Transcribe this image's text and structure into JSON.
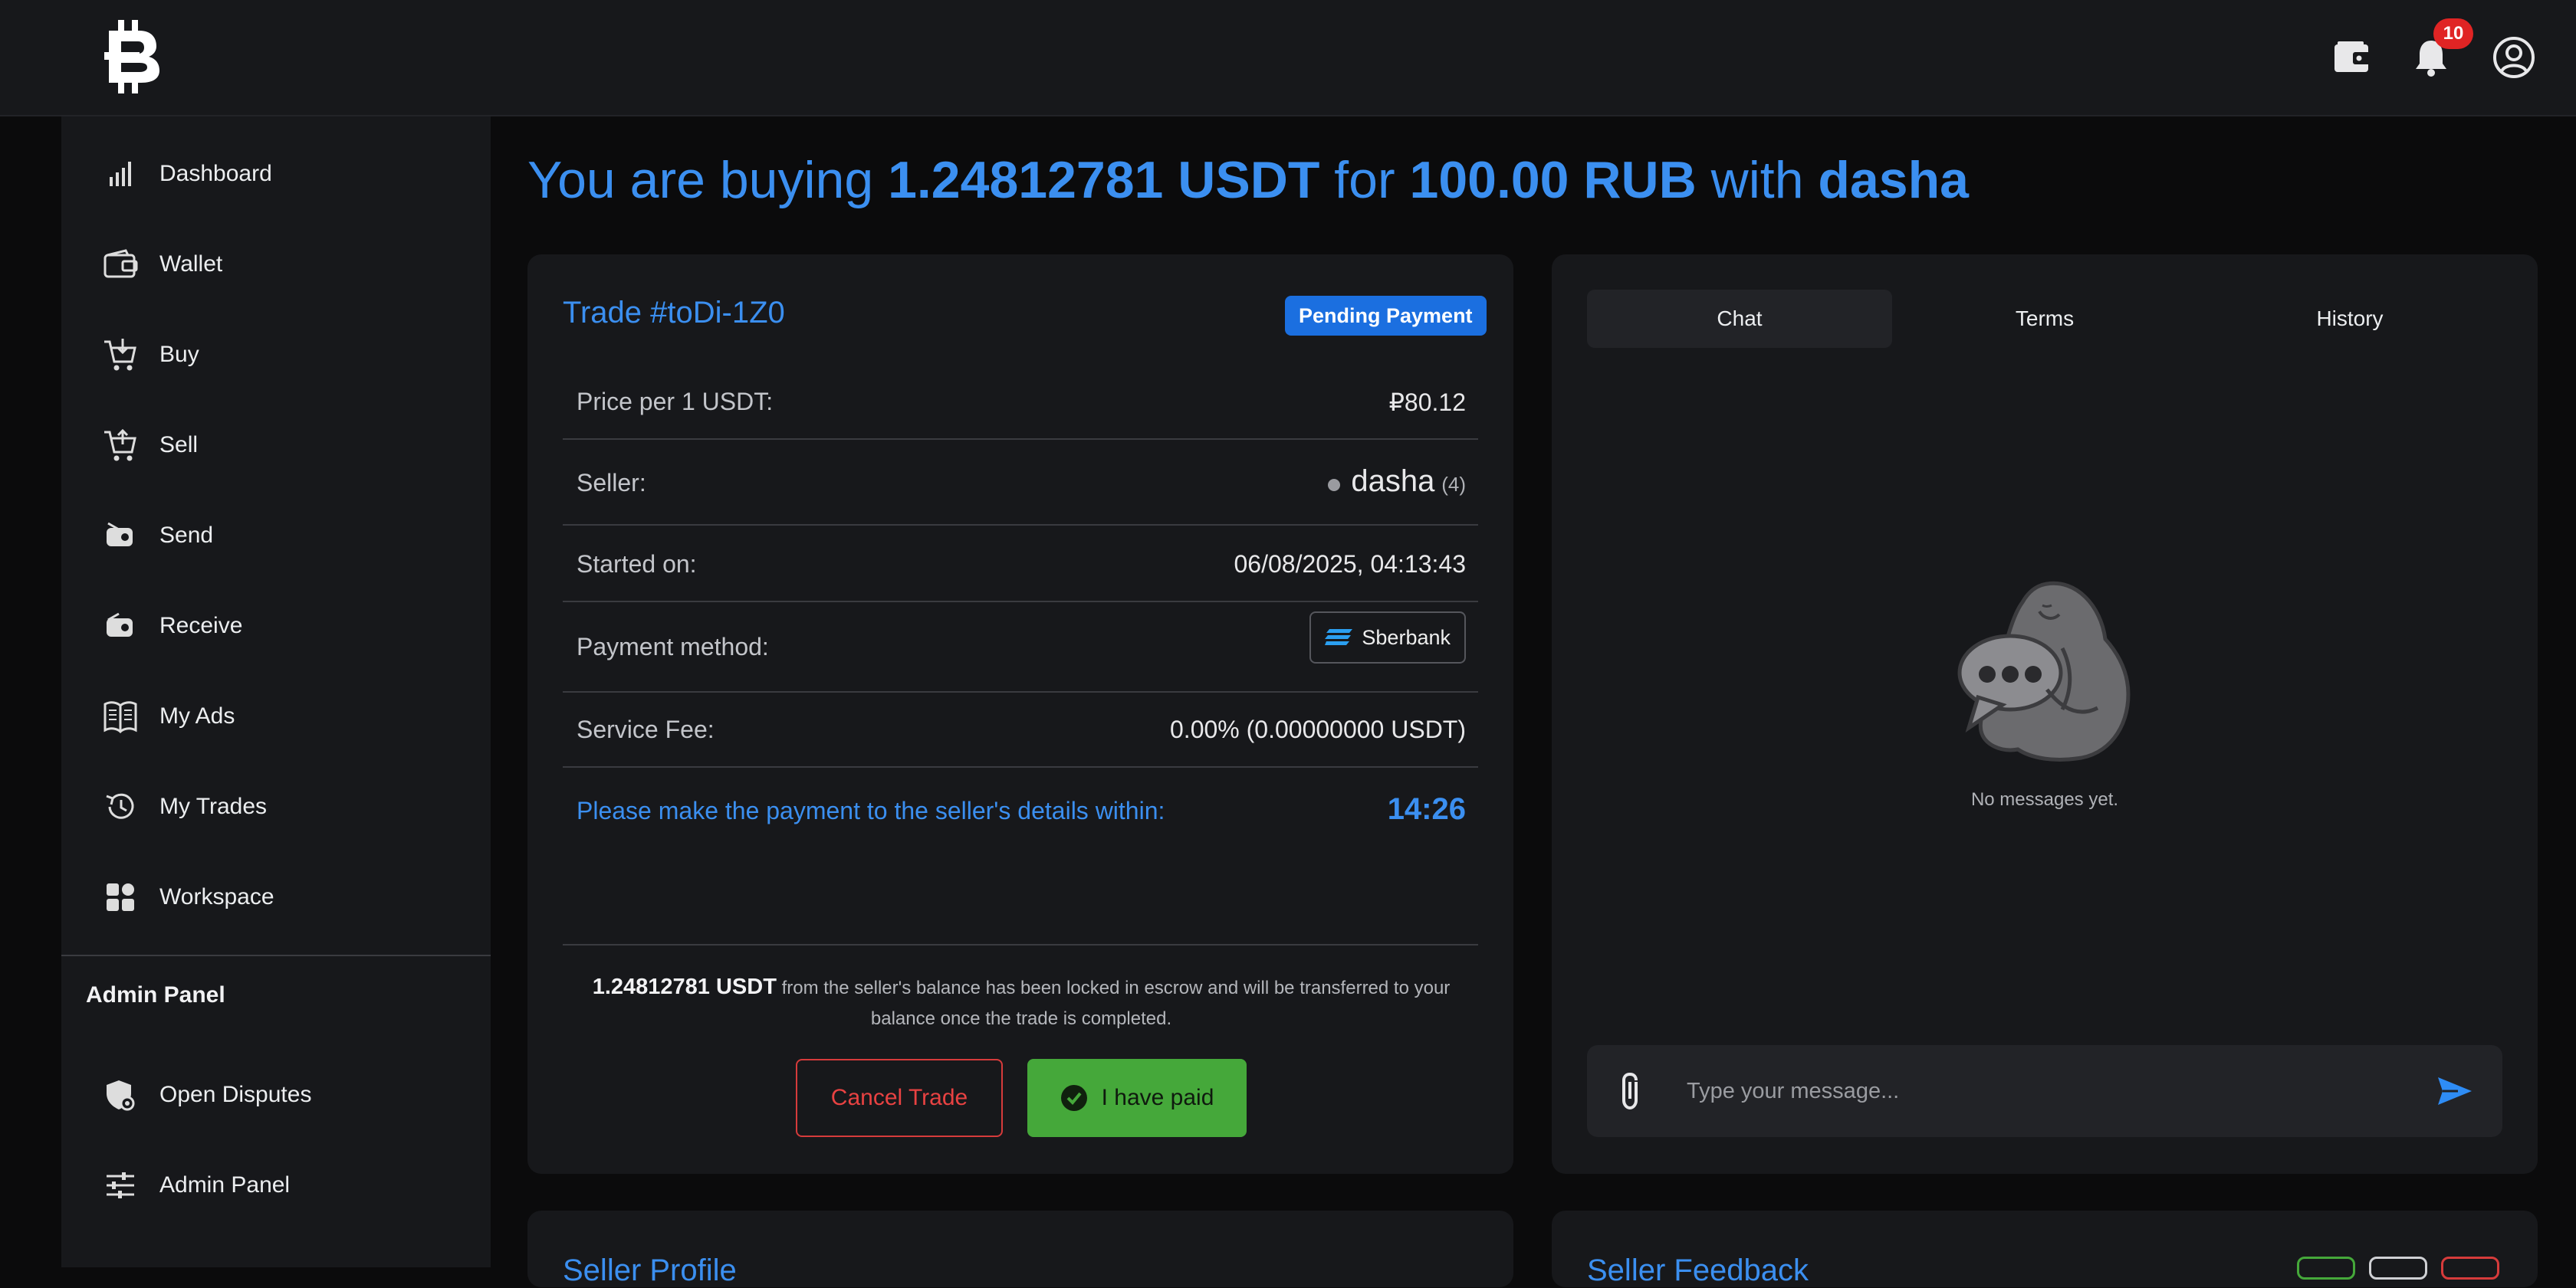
{
  "topbar": {
    "logo_icon": "bitcoin-b-icon",
    "wallet_icon": "wallet-icon",
    "notifications_icon": "bell-icon",
    "notifications_count": "10",
    "account_icon": "user-circle-icon"
  },
  "sidebar": {
    "items": [
      {
        "label": "Dashboard",
        "icon": "bar-chart-icon"
      },
      {
        "label": "Wallet",
        "icon": "wallet-icon"
      },
      {
        "label": "Buy",
        "icon": "cart-down-icon"
      },
      {
        "label": "Sell",
        "icon": "cart-up-icon"
      },
      {
        "label": "Send",
        "icon": "send-money-icon"
      },
      {
        "label": "Receive",
        "icon": "receive-money-icon"
      },
      {
        "label": "My Ads",
        "icon": "book-icon"
      },
      {
        "label": "My Trades",
        "icon": "history-icon"
      },
      {
        "label": "Workspace",
        "icon": "grid-icon"
      }
    ],
    "admin_title": "Admin Panel",
    "admin_items": [
      {
        "label": "Open Disputes",
        "icon": "shield-gear-icon"
      },
      {
        "label": "Admin Panel",
        "icon": "sliders-icon"
      }
    ]
  },
  "heading": {
    "prefix": "You are buying ",
    "amount": "1.24812781 USDT",
    "for_word": " for ",
    "fiat": "100.00 RUB",
    "with_word": " with ",
    "counterparty": "dasha"
  },
  "trade": {
    "title": "Trade #toDi-1Z0",
    "status": "Pending Payment",
    "rows": {
      "price_label": "Price per 1 USDT:",
      "price_value": "₽80.12",
      "seller_label": "Seller:",
      "seller_name": "dasha",
      "seller_count": "(4)",
      "started_label": "Started on:",
      "started_value": "06/08/2025, 04:13:43",
      "payment_label": "Payment method:",
      "payment_value": "Sberbank",
      "fee_label": "Service Fee:",
      "fee_value": "0.00% (0.00000000 USDT)"
    },
    "countdown_label": "Please make the payment to the seller's details within:",
    "countdown": "14:26",
    "escrow_amount": "1.24812781 USDT",
    "escrow_text": " from the seller's balance has been locked in escrow and will be transferred to your balance once the trade is completed.",
    "cancel_label": "Cancel Trade",
    "paid_label": "I have paid"
  },
  "chat": {
    "tabs": [
      "Chat",
      "Terms",
      "History"
    ],
    "active_tab": "Chat",
    "empty_text": "No messages yet.",
    "input_placeholder": "Type your message...",
    "attach_icon": "paperclip-icon",
    "send_icon": "send-arrow-icon"
  },
  "below": {
    "left_title": "Seller Profile",
    "right_title": "Seller Feedback"
  },
  "colors": {
    "accent": "#3b8ff0",
    "status_badge": "#1b6fe0",
    "danger": "#e84242",
    "success": "#45a83a",
    "panel": "#17181b"
  }
}
